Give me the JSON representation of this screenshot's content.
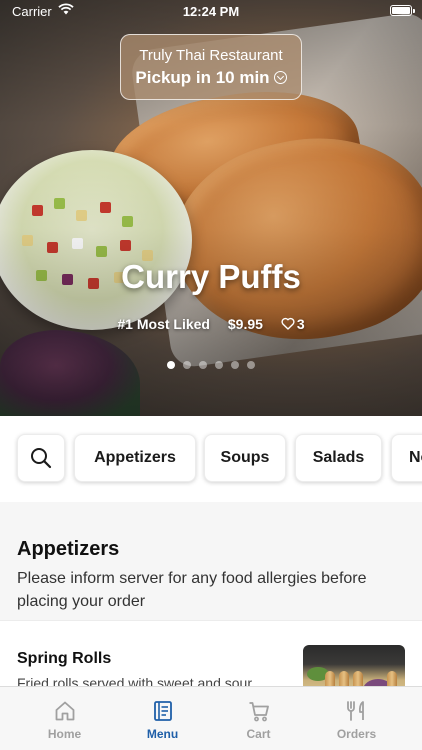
{
  "status_bar": {
    "carrier": "Carrier",
    "time": "12:24 PM"
  },
  "pickup": {
    "restaurant": "Truly Thai Restaurant",
    "pickup_time": "Pickup in 10 min"
  },
  "hero": {
    "title": "Curry Puffs",
    "badge": "#1 Most Liked",
    "price": "$9.95",
    "likes": "3",
    "carousel": {
      "count": 6,
      "active_index": 0
    }
  },
  "categories": [
    "Appetizers",
    "Soups",
    "Salads",
    "Noodles"
  ],
  "section": {
    "title": "Appetizers",
    "description": "Please inform server for any food allergies before placing your order"
  },
  "items": [
    {
      "name": "Spring Rolls",
      "description": "Fried rolls served with sweet and sour"
    }
  ],
  "tabs": [
    {
      "label": "Home",
      "icon": "home-icon"
    },
    {
      "label": "Menu",
      "icon": "menu-book-icon",
      "active": true
    },
    {
      "label": "Cart",
      "icon": "cart-icon"
    },
    {
      "label": "Orders",
      "icon": "utensils-icon"
    }
  ],
  "colors": {
    "accent": "#1f5fa8",
    "inactive_tab": "#a0a0a0"
  }
}
